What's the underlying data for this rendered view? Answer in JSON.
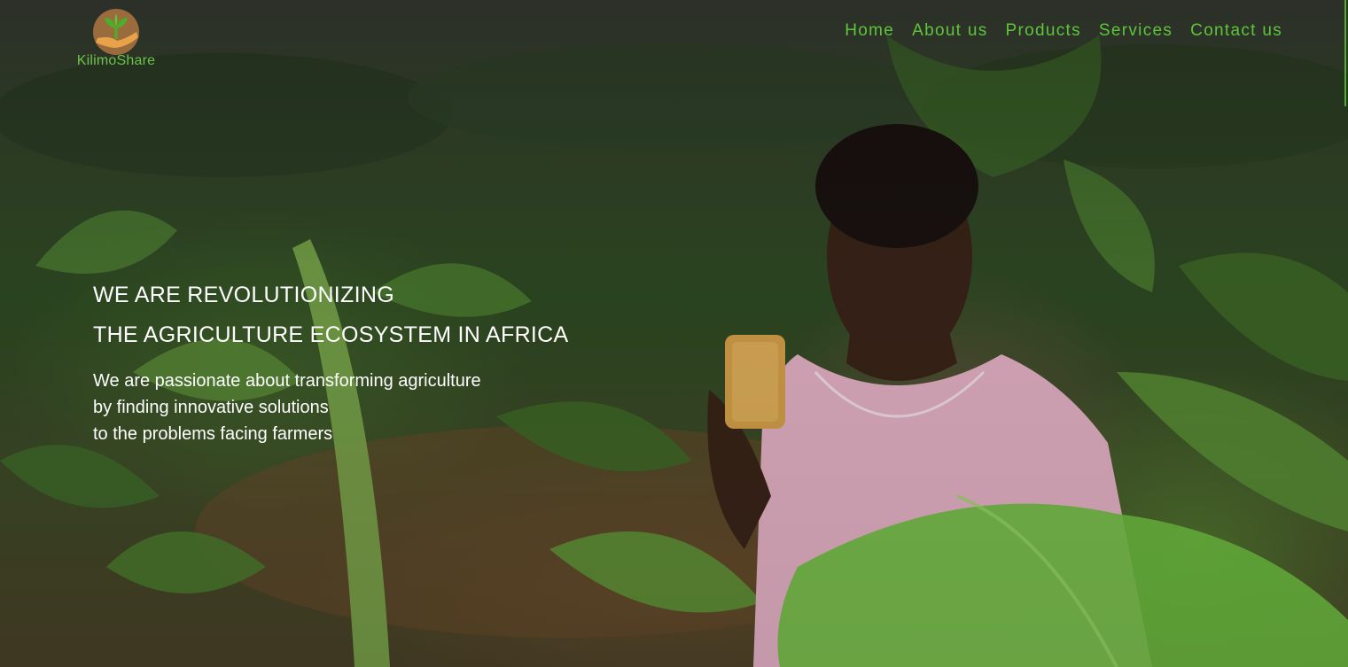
{
  "brand": {
    "logo_text": "KilimoShare",
    "logo_icon": "sprout-in-hand-icon",
    "accent_color": "#5fc43c",
    "logo_circle_color": "#9a6b3c"
  },
  "nav": {
    "items": [
      {
        "label": "Home"
      },
      {
        "label": "About us"
      },
      {
        "label": "Products"
      },
      {
        "label": "Services"
      },
      {
        "label": "Contact us"
      }
    ]
  },
  "hero": {
    "headline_line1": "WE ARE REVOLUTIONIZING",
    "headline_line2": "THE AGRICULTURE ECOSYSTEM IN AFRICA",
    "subtext_line1": "We are passionate about transforming agriculture",
    "subtext_line2": "by finding innovative solutions",
    "subtext_line3": "to the problems facing farmers"
  }
}
